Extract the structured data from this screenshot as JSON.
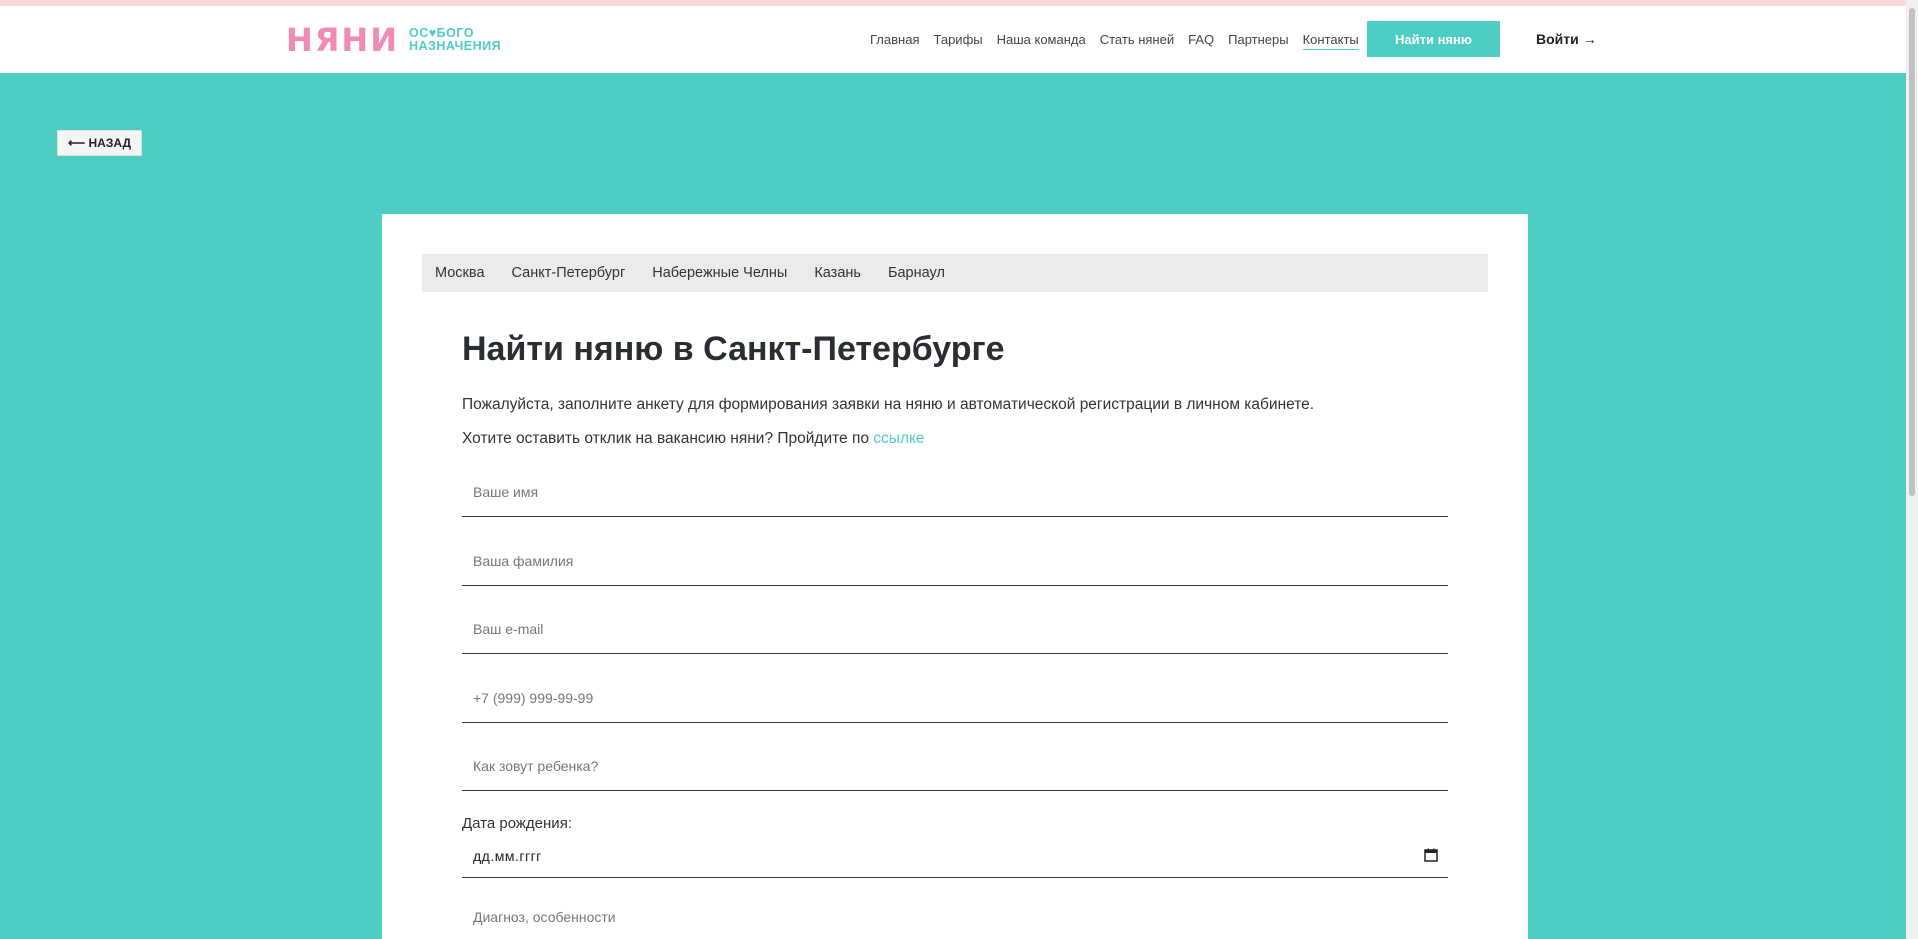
{
  "header": {
    "logo_main": "НЯНИ",
    "logo_sub_1": "ОС♥БОГО",
    "logo_sub_2": "НАЗНАЧЕНИЯ",
    "nav": [
      "Главная",
      "Тарифы",
      "Наша команда",
      "Стать няней",
      "FAQ",
      "Партнеры",
      "Контакты"
    ],
    "find_button": "Найти няню",
    "login": "Войти →"
  },
  "back_button": "⟵ НАЗАД",
  "cities": [
    "Москва",
    "Санкт-Петербург",
    "Набережные Челны",
    "Казань",
    "Барнаул"
  ],
  "form": {
    "title": "Найти няню в Санкт-Петербурге",
    "description": "Пожалуйста, заполните анкету для формирования заявки на няню и автоматической регистрации в личном кабинете.",
    "vacancy_text": "Хотите оставить отклик на вакансию няни? Пройдите по ",
    "vacancy_link": "ссылке",
    "placeholders": {
      "first_name": "Ваше имя",
      "last_name": "Ваша фамилия",
      "email": "Ваш e-mail",
      "phone": "+7 (999) 999-99-99",
      "child_name": "Как зовут ребенка?",
      "diagnosis": "Диагноз, особенности"
    },
    "dob_label": "Дата рождения:",
    "dob_value": "дд.мм.гггг"
  },
  "colors": {
    "accent": "#4ecdc4",
    "brand_pink": "#f08bb5"
  }
}
